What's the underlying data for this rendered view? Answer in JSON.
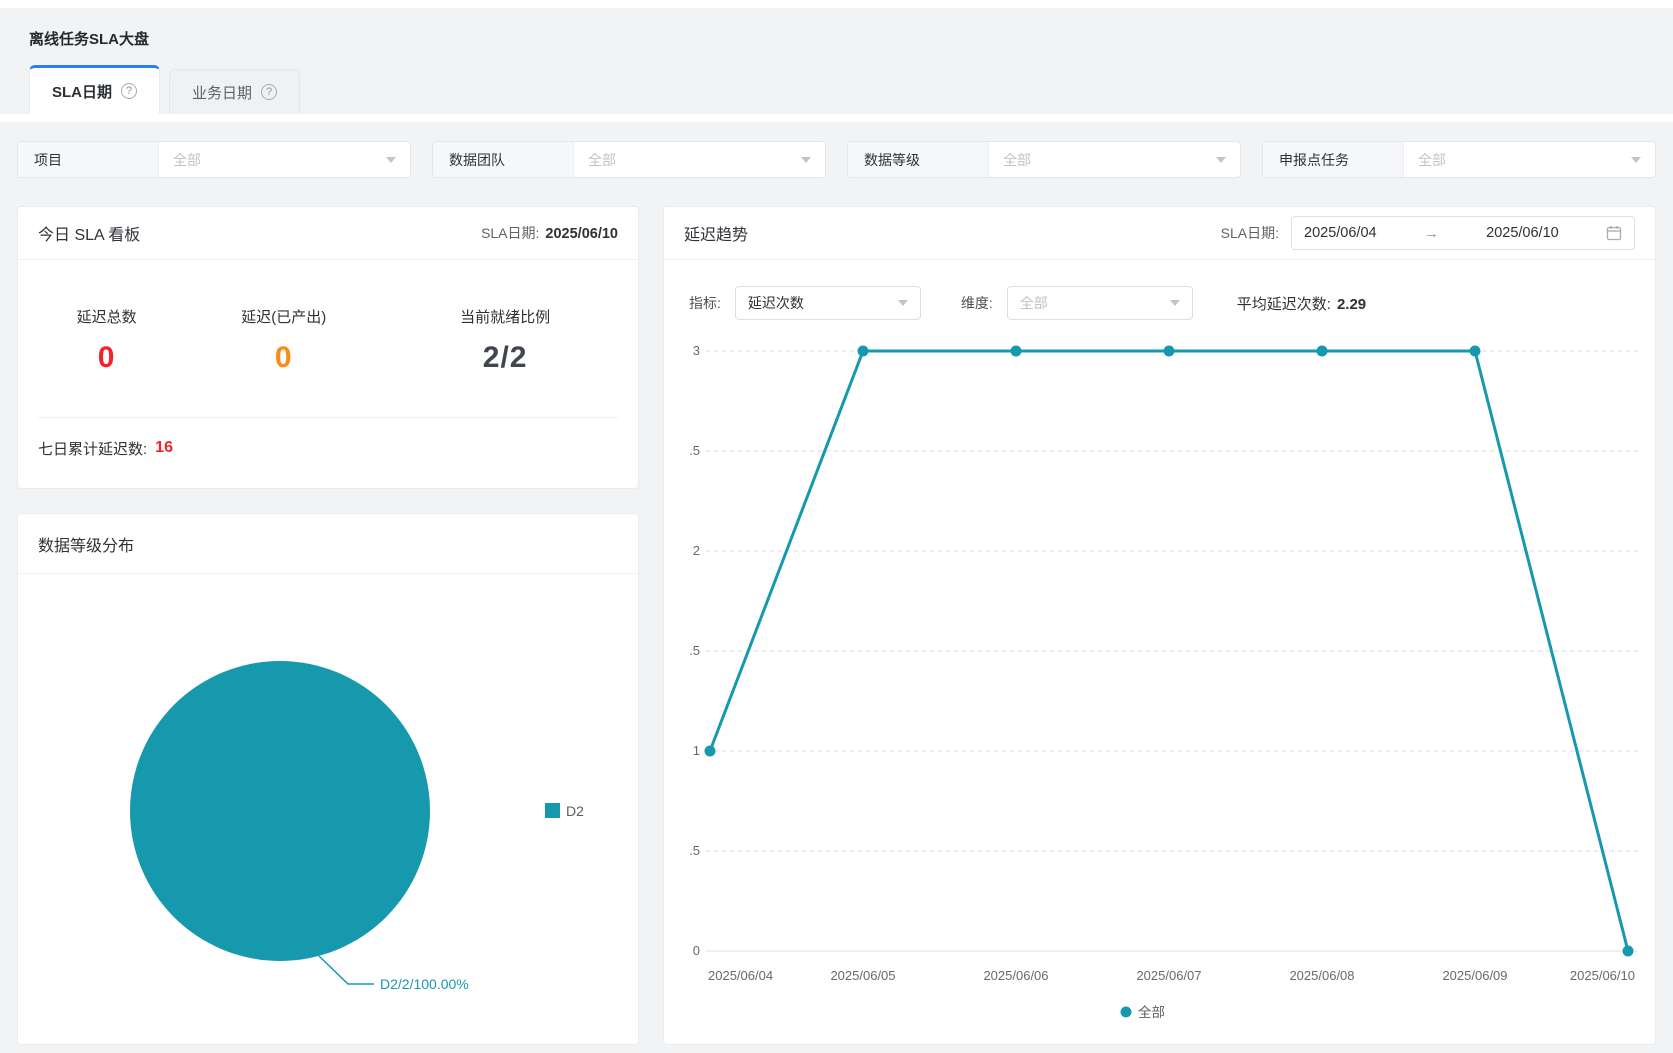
{
  "page": {
    "title": "离线任务SLA大盘"
  },
  "icons": {
    "help": "?"
  },
  "tabs": [
    {
      "label": "SLA日期",
      "active": true
    },
    {
      "label": "业务日期",
      "active": false
    }
  ],
  "filters": [
    {
      "label": "项目",
      "value": "全部"
    },
    {
      "label": "数据团队",
      "value": "全部"
    },
    {
      "label": "数据等级",
      "value": "全部"
    },
    {
      "label": "申报点任务",
      "value": "全部"
    }
  ],
  "today_card": {
    "title": "今日 SLA 看板",
    "date_label": "SLA日期:",
    "date_value": "2025/06/10",
    "stats": [
      {
        "label": "延迟总数",
        "value": "0",
        "color": "#f5222d"
      },
      {
        "label": "延迟(已产出)",
        "value": "0",
        "color": "#fa8c16"
      },
      {
        "label": "当前就绪比例",
        "value": "2/2",
        "color": "#41454d"
      }
    ],
    "footer_label": "七日累计延迟数:",
    "footer_value": "16",
    "footer_value_color": "#f5222d"
  },
  "distribution_card": {
    "title": "数据等级分布"
  },
  "trend_card": {
    "title": "延迟趋势",
    "date_label": "SLA日期:",
    "date_start": "2025/06/04",
    "date_end": "2025/06/10",
    "metric_label": "指标:",
    "metric_value": "延迟次数",
    "dimension_label": "维度:",
    "dimension_value": "全部",
    "avg_label": "平均延迟次数:",
    "avg_value": "2.29"
  },
  "colors": {
    "teal": "#1799ad",
    "accent_blue": "#2b7cf7"
  },
  "chart_data": [
    {
      "type": "pie",
      "title": "数据等级分布",
      "series": [
        {
          "name": "D2",
          "value": 2,
          "percent": "100.00%"
        }
      ],
      "slice_label": "D2/2/100.00%",
      "legend": [
        "D2"
      ],
      "legend_position": "right",
      "color": "#1799ad"
    },
    {
      "type": "line",
      "title": "延迟趋势",
      "x": [
        "2025/06/04",
        "2025/06/05",
        "2025/06/06",
        "2025/06/07",
        "2025/06/08",
        "2025/06/09",
        "2025/06/10"
      ],
      "series": [
        {
          "name": "全部",
          "values": [
            1,
            3,
            3,
            3,
            3,
            3,
            0
          ]
        }
      ],
      "ylim": [
        0,
        3
      ],
      "y_tick_labels": [
        "3",
        ".5",
        "2",
        ".5",
        "1",
        ".5",
        "0"
      ],
      "grid": true,
      "legend_position": "bottom",
      "average": 2.29,
      "color": "#1799ad"
    }
  ]
}
